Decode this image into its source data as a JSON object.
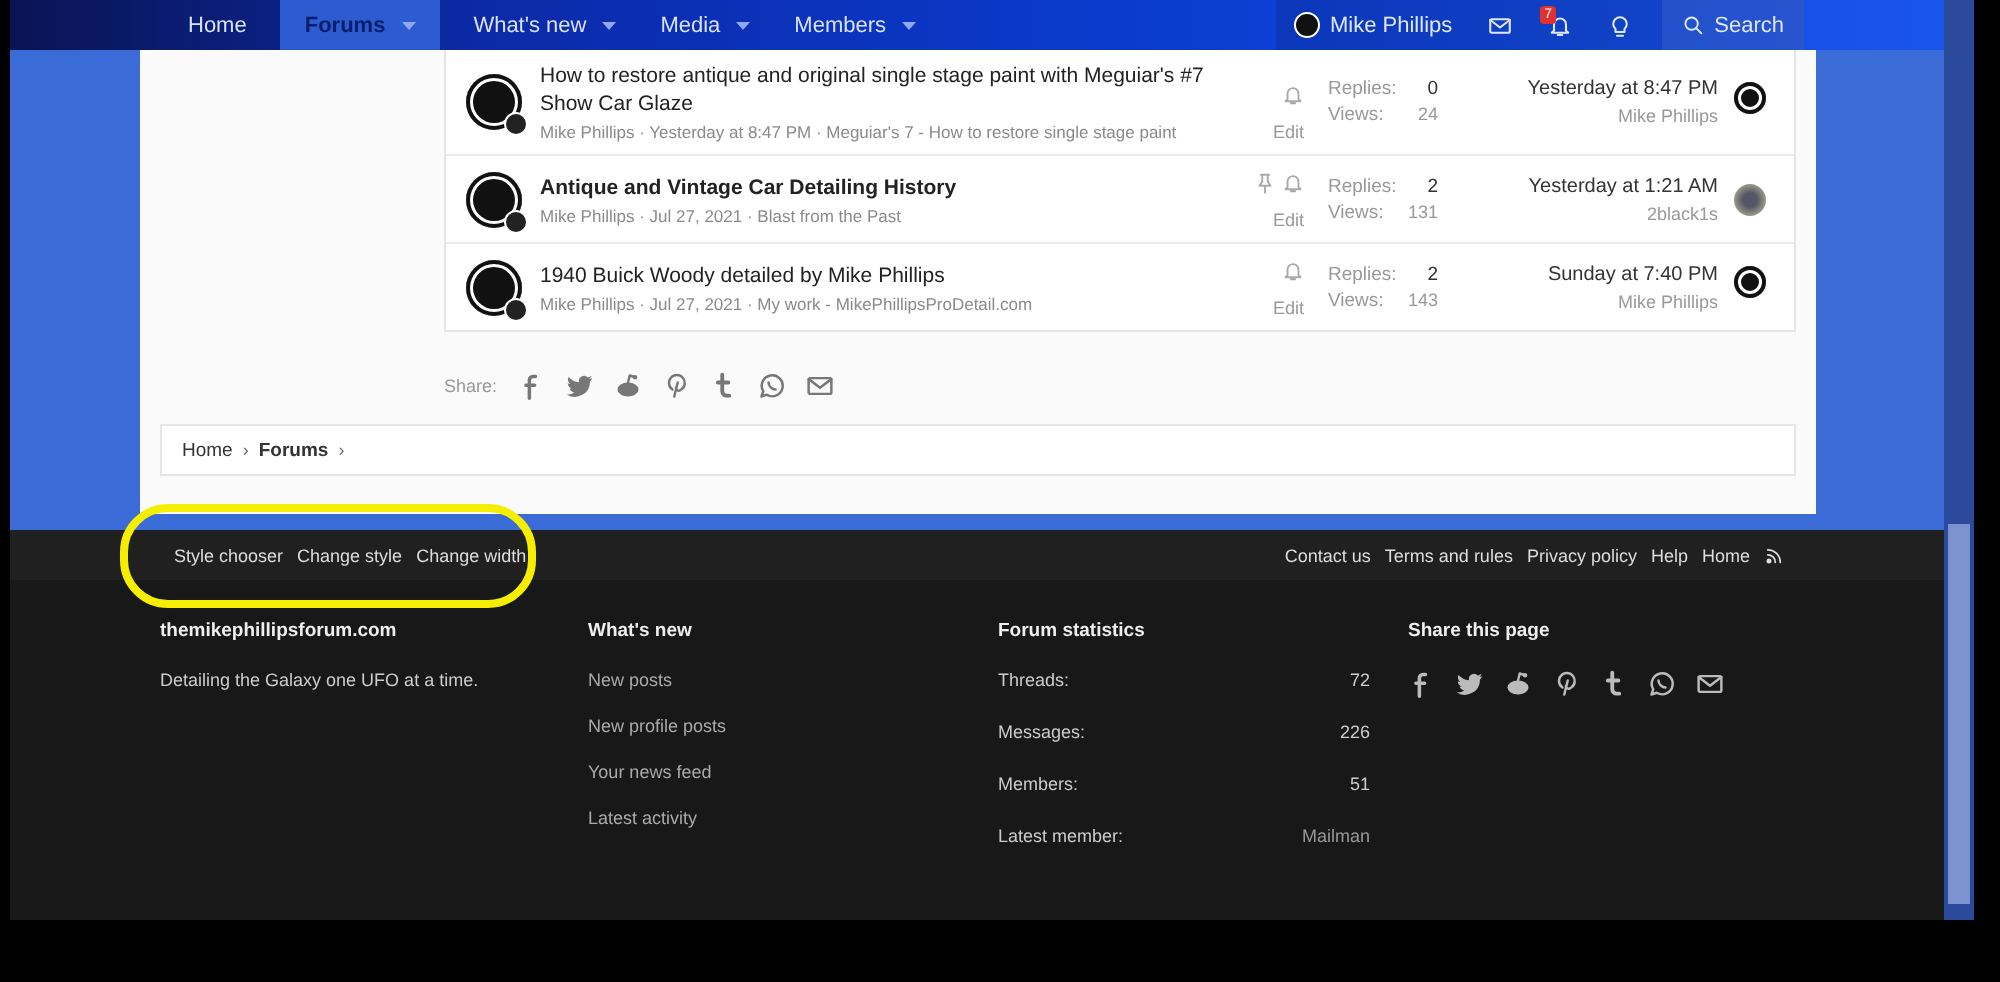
{
  "nav": {
    "items": [
      {
        "label": "Home",
        "selected": false,
        "has_menu": false
      },
      {
        "label": "Forums",
        "selected": true,
        "has_menu": true
      },
      {
        "label": "What's new",
        "selected": false,
        "has_menu": true
      },
      {
        "label": "Media",
        "selected": false,
        "has_menu": true
      },
      {
        "label": "Members",
        "selected": false,
        "has_menu": true
      }
    ],
    "user": {
      "name": "Mike Phillips"
    },
    "alerts_badge": "7",
    "search": "Search"
  },
  "threads": [
    {
      "title": "How to restore antique and original single stage paint with Meguiar's #7 Show Car Glaze",
      "unread": false,
      "sticky": false,
      "watched": true,
      "meta": "Mike Phillips · Yesterday at 8:47 PM · Meguiar's 7 - How to restore single stage paint",
      "edit": "Edit",
      "replies_label": "Replies:",
      "replies": "0",
      "views_label": "Views:",
      "views": "24",
      "last_time": "Yesterday at 8:47 PM",
      "last_user": "Mike Phillips",
      "last_avatar_photo": false
    },
    {
      "title": "Antique and Vintage Car Detailing History",
      "unread": true,
      "sticky": true,
      "watched": true,
      "meta": "Mike Phillips · Jul 27, 2021 · Blast from the Past",
      "edit": "Edit",
      "replies_label": "Replies:",
      "replies": "2",
      "views_label": "Views:",
      "views": "131",
      "last_time": "Yesterday at 1:21 AM",
      "last_user": "2black1s",
      "last_avatar_photo": true
    },
    {
      "title": "1940 Buick Woody detailed by Mike Phillips",
      "unread": false,
      "sticky": false,
      "watched": true,
      "meta": "Mike Phillips · Jul 27, 2021 · My work - MikePhillipsProDetail.com",
      "edit": "Edit",
      "replies_label": "Replies:",
      "replies": "2",
      "views_label": "Views:",
      "views": "143",
      "last_time": "Sunday at 7:40 PM",
      "last_user": "Mike Phillips",
      "last_avatar_photo": false
    }
  ],
  "share": {
    "label": "Share:"
  },
  "breadcrumb": [
    {
      "label": "Home",
      "current": false,
      "separator": "›"
    },
    {
      "label": "Forums",
      "current": true,
      "separator": "›"
    }
  ],
  "footer_bar": {
    "left": [
      "Style chooser",
      "Change style",
      "Change width"
    ],
    "right": [
      "Contact us",
      "Terms and rules",
      "Privacy policy",
      "Help",
      "Home"
    ]
  },
  "footer": {
    "brand": "themikephillipsforum.com",
    "tagline": "Detailing the Galaxy one UFO at a time.",
    "whats_new": {
      "title": "What's new",
      "links": [
        "New posts",
        "New profile posts",
        "Your news feed",
        "Latest activity"
      ]
    },
    "stats": {
      "title": "Forum statistics",
      "rows": [
        {
          "label": "Threads:",
          "value": "72"
        },
        {
          "label": "Messages:",
          "value": "226"
        },
        {
          "label": "Members:",
          "value": "51"
        },
        {
          "label": "Latest member:",
          "value": "Mailman"
        }
      ]
    },
    "share_title": "Share this page"
  }
}
